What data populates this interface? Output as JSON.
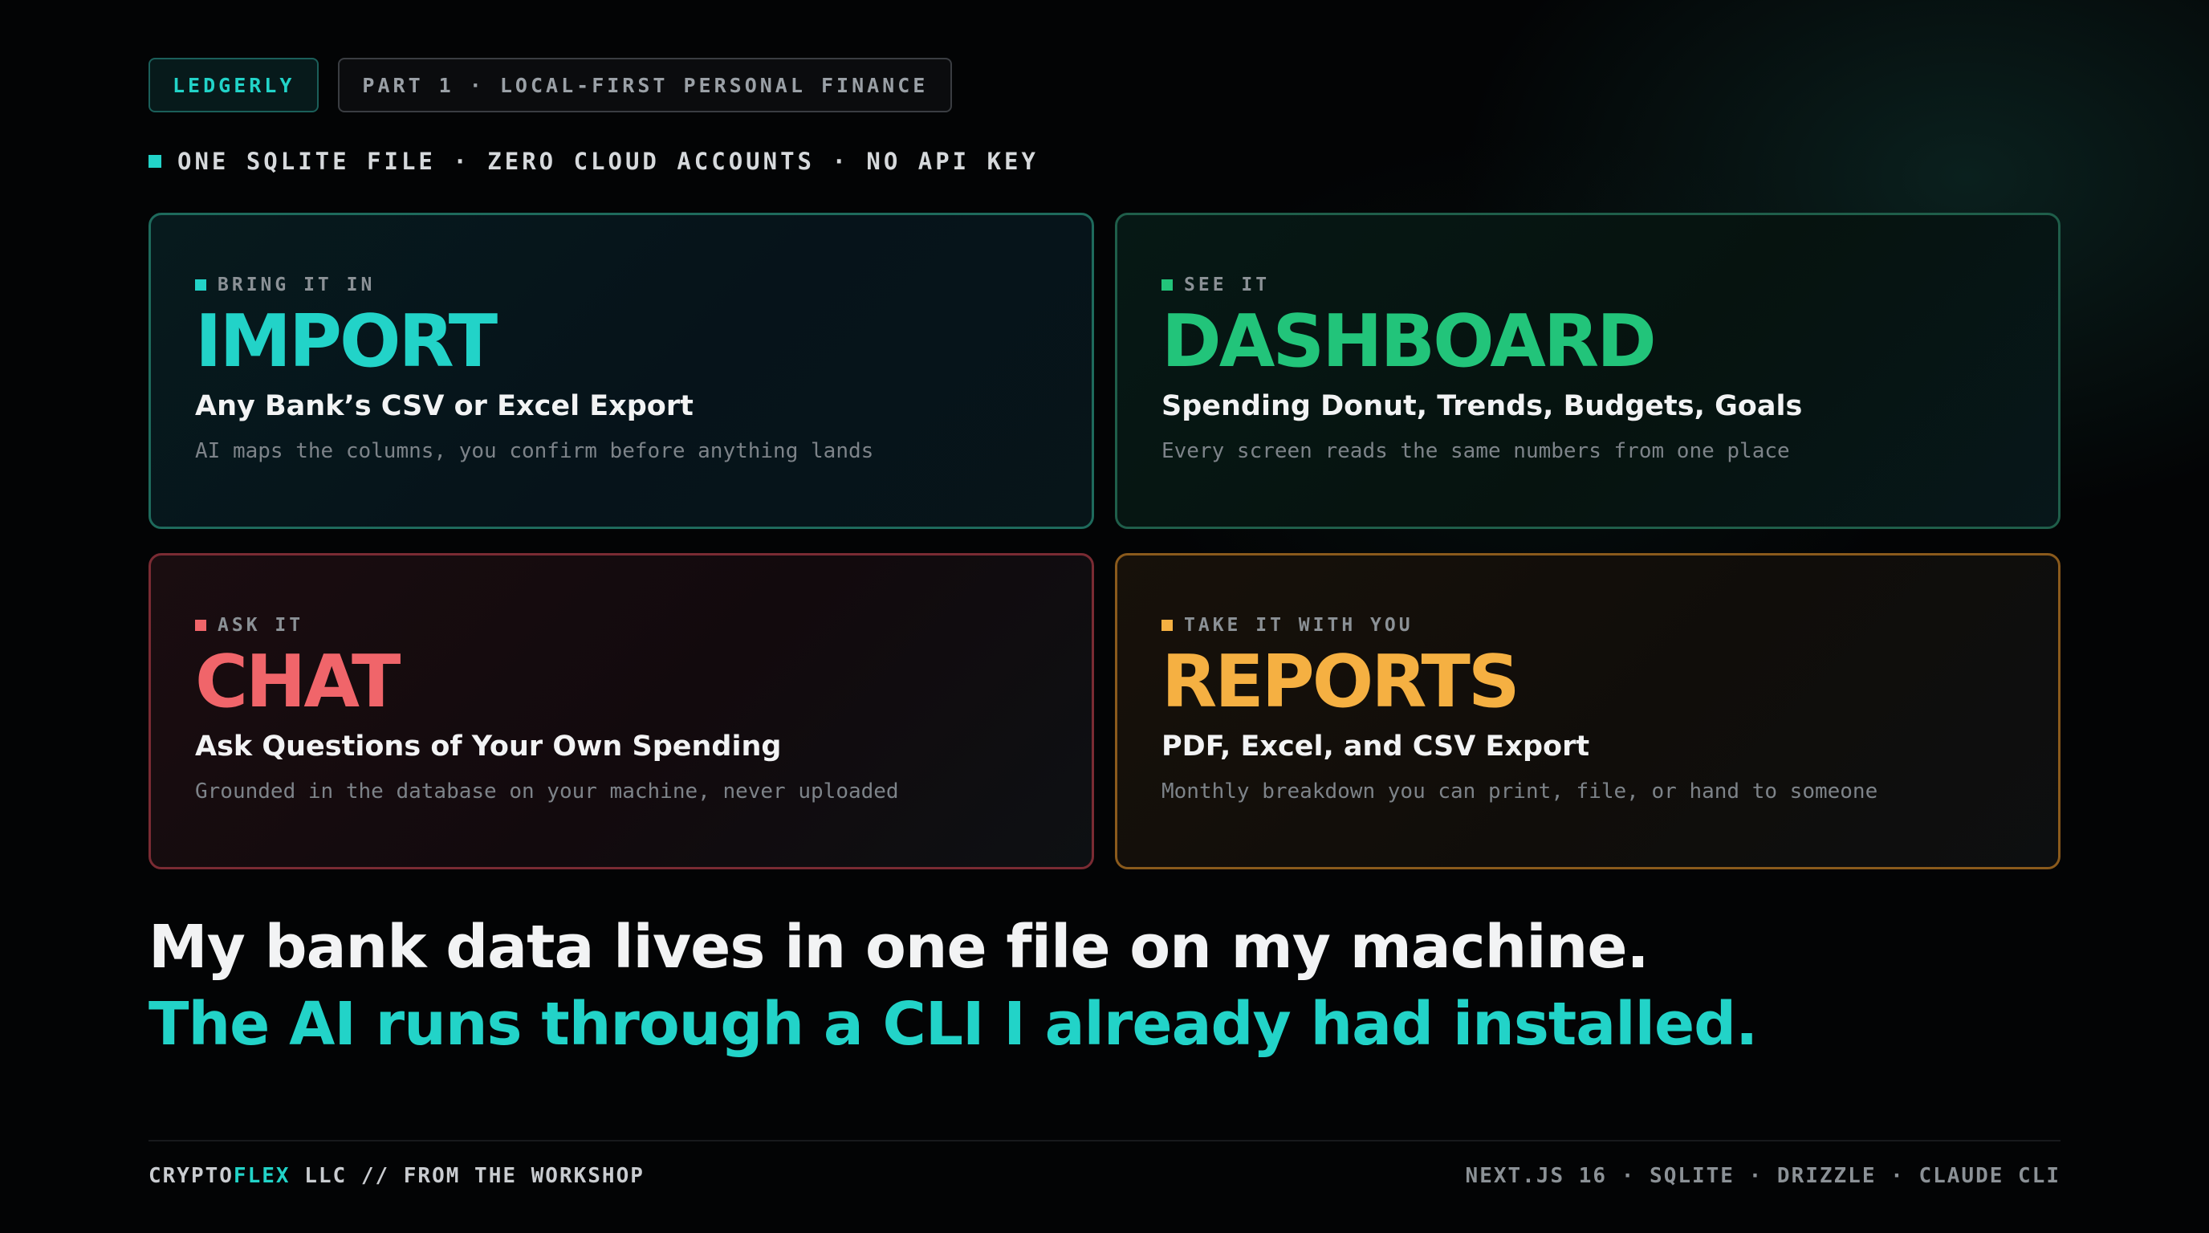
{
  "colors": {
    "teal": "#22d3c8",
    "green": "#22c47a",
    "red": "#f0656a",
    "amber": "#f5b042"
  },
  "header": {
    "brand": "LEDGERLY",
    "part": "PART 1 · LOCAL-FIRST PERSONAL FINANCE"
  },
  "tagline": "ONE SQLITE FILE · ZERO CLOUD ACCOUNTS · NO API KEY",
  "cards": {
    "import": {
      "eyebrow": "BRING IT IN",
      "title": "IMPORT",
      "subtitle": "Any Bank’s CSV or Excel Export",
      "description": "AI maps the columns, you confirm before anything lands"
    },
    "dashboard": {
      "eyebrow": "SEE IT",
      "title": "DASHBOARD",
      "subtitle": "Spending Donut, Trends, Budgets, Goals",
      "description": "Every screen reads the same numbers from one place"
    },
    "chat": {
      "eyebrow": "ASK IT",
      "title": "CHAT",
      "subtitle": "Ask Questions of Your Own Spending",
      "description": "Grounded in the database on your machine, never uploaded"
    },
    "reports": {
      "eyebrow": "TAKE IT WITH YOU",
      "title": "REPORTS",
      "subtitle": "PDF, Excel, and CSV Export",
      "description": "Monthly breakdown you can print, file, or hand to someone"
    }
  },
  "headline": {
    "line1": "My bank data lives in one file on my machine.",
    "line2": "The AI runs through a CLI I already had installed."
  },
  "footer": {
    "left_prefix": "CRYPTO",
    "left_accent": "FLEX",
    "left_suffix": " LLC // FROM THE WORKSHOP",
    "right": "NEXT.JS 16 · SQLITE · DRIZZLE · CLAUDE CLI"
  }
}
